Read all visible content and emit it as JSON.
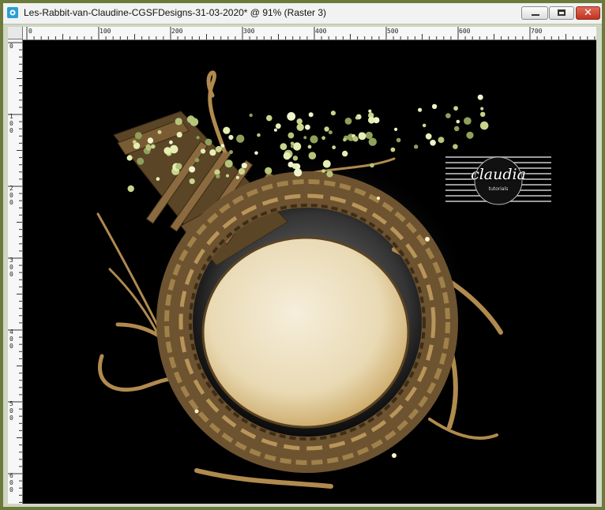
{
  "window": {
    "title": "Les-Rabbit-van-Claudine-CGSFDesigns-31-03-2020* @  91% (Raster 3)",
    "buttons": {
      "minimize": "minimize-button",
      "maximize": "maximize-button",
      "close": "✕"
    }
  },
  "ruler": {
    "horizontal_labels": [
      "0",
      "100",
      "200",
      "300",
      "400",
      "500",
      "600",
      "700"
    ],
    "vertical_labels": [
      "0",
      "1\n0\n0",
      "2\n0\n0",
      "3\n0\n0",
      "4\n0\n0",
      "5\n0\n0",
      "6\n0\n0"
    ]
  },
  "canvas": {
    "watermark_text": "claudia",
    "watermark_subtext": "tutorials"
  },
  "colors": {
    "window_border": "#6b7a3a",
    "canvas_background": "#000000",
    "wreath": "#8a6a3a",
    "frame_inner": "#efe4c6",
    "flowers": "#dfe6a8"
  }
}
